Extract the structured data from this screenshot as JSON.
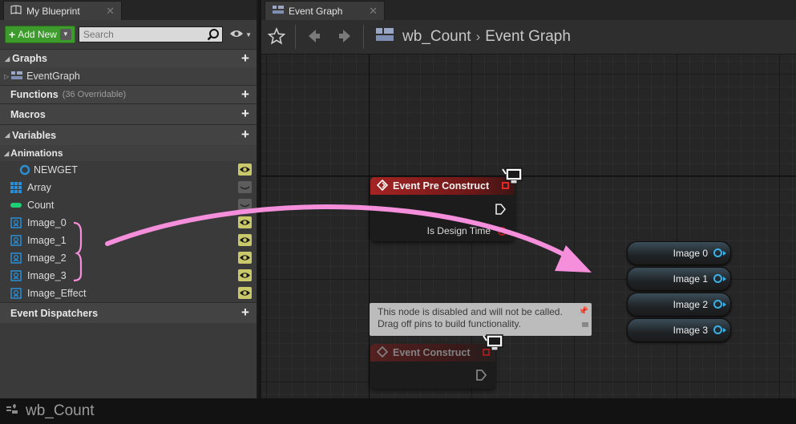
{
  "left_panel": {
    "tab_title": "My Blueprint",
    "add_new_label": "Add New",
    "search_placeholder": "Search",
    "sections": {
      "graphs": "Graphs",
      "event_graph_item": "EventGraph",
      "functions": "Functions",
      "functions_note": "(36 Overridable)",
      "macros": "Macros",
      "variables": "Variables",
      "animations": "Animations",
      "event_dispatchers": "Event Dispatchers"
    },
    "variables": [
      {
        "name": "NEWGET",
        "icon": "ring-icon",
        "color": "#2a8fd6",
        "visible": true
      },
      {
        "name": "Array",
        "icon": "grid-icon",
        "color": "#2a8fd6",
        "visible": false
      },
      {
        "name": "Count",
        "icon": "pill-icon",
        "color": "#1fcf73",
        "visible": false
      },
      {
        "name": "Image_0",
        "icon": "image-var-icon",
        "color": "#2a8fd6",
        "visible": true
      },
      {
        "name": "Image_1",
        "icon": "image-var-icon",
        "color": "#2a8fd6",
        "visible": true
      },
      {
        "name": "Image_2",
        "icon": "image-var-icon",
        "color": "#2a8fd6",
        "visible": true
      },
      {
        "name": "Image_3",
        "icon": "image-var-icon",
        "color": "#2a8fd6",
        "visible": true
      },
      {
        "name": "Image_Effect",
        "icon": "image-var-icon",
        "color": "#2a8fd6",
        "visible": true
      }
    ]
  },
  "graph_panel": {
    "tab_title": "Event Graph",
    "breadcrumb_root": "wb_Count",
    "breadcrumb_leaf": "Event Graph",
    "nodes": {
      "pre_construct_title": "Event Pre Construct",
      "pre_construct_pin": "Is Design Time",
      "construct_title": "Event Construct",
      "comment": "This node is disabled and will not be called. Drag off pins to build functionality.",
      "comment_line1": "This node is disabled and will not be called.",
      "comment_line2": "Drag off pins to build functionality."
    },
    "get_nodes": [
      "Image 0",
      "Image 1",
      "Image 2",
      "Image 3"
    ],
    "colors": {
      "event_header": "#8a1c1c",
      "pin_blue": "#3ab0e8",
      "annotation_pink": "#f58fdc"
    }
  },
  "status_bar": {
    "blueprint_name": "wb_Count"
  }
}
